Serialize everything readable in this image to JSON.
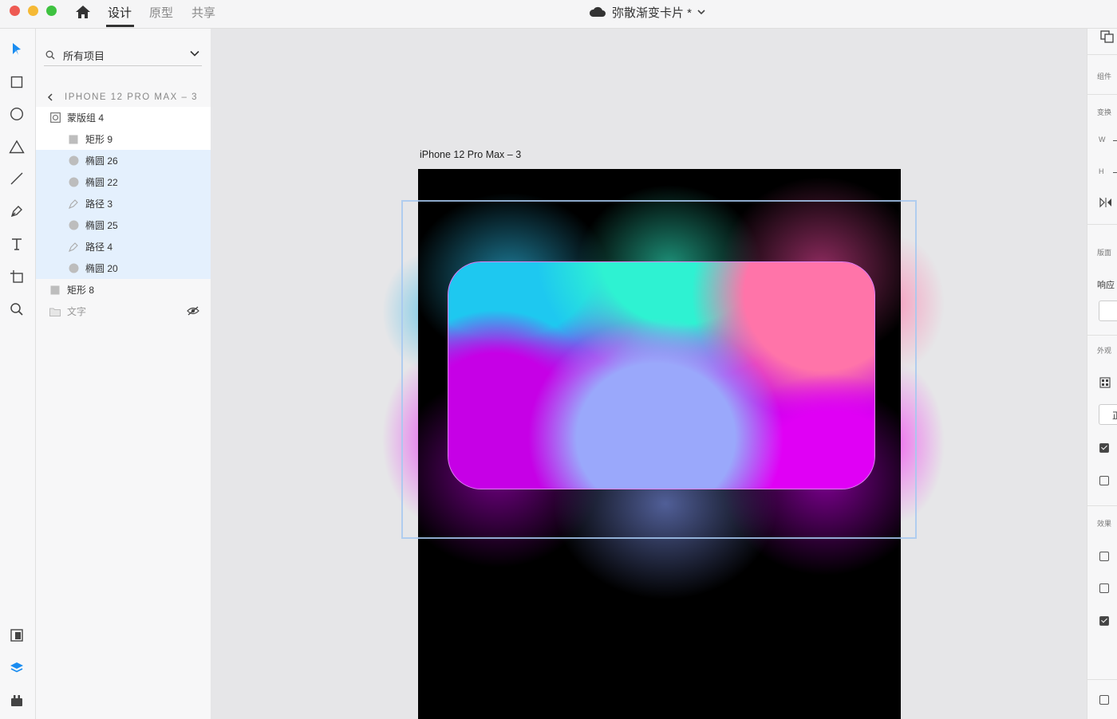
{
  "window": {
    "tabs": [
      {
        "label": "设计",
        "active": true
      },
      {
        "label": "原型",
        "active": false
      },
      {
        "label": "共享",
        "active": false
      }
    ],
    "doc_title": "弥散渐变卡片 *",
    "icons": [
      "home-icon",
      "cloud-icon",
      "chevron-down-icon"
    ]
  },
  "toolbar": {
    "tools": [
      "select-icon",
      "rectangle-icon",
      "ellipse-icon",
      "polygon-icon",
      "line-icon",
      "pen-icon",
      "text-icon",
      "artboard-icon",
      "zoom-icon"
    ],
    "bottom_tools": [
      "assets-icon",
      "layers-icon",
      "plugins-icon"
    ]
  },
  "layers": {
    "search_placeholder": "所有项目",
    "breadcrumb": "IPHONE 12 PRO MAX – 3",
    "items": [
      {
        "label": "蒙版组 4",
        "icon": "mask-group-icon",
        "state": "white"
      },
      {
        "label": "矩形 9",
        "icon": "rectangle-layer-icon",
        "state": "white"
      },
      {
        "label": "椭圆 26",
        "icon": "ellipse-layer-icon",
        "state": "selected"
      },
      {
        "label": "椭圆 22",
        "icon": "ellipse-layer-icon",
        "state": "selected"
      },
      {
        "label": "路径 3",
        "icon": "path-layer-icon",
        "state": "selected"
      },
      {
        "label": "椭圆 25",
        "icon": "ellipse-layer-icon",
        "state": "selected"
      },
      {
        "label": "路径 4",
        "icon": "path-layer-icon",
        "state": "selected"
      },
      {
        "label": "椭圆 20",
        "icon": "ellipse-layer-icon",
        "state": "selected"
      },
      {
        "label": "矩形 8",
        "icon": "rectangle-layer-icon",
        "state": "none"
      },
      {
        "label": "文字",
        "icon": "folder-icon",
        "state": "hidden"
      }
    ]
  },
  "canvas": {
    "artboard_label": "iPhone 12 Pro Max – 3",
    "colors": {
      "artboard": "#000000",
      "cyan": "#1ec8f0",
      "mint": "#2ef2d2",
      "pink": "#ff74a9",
      "magenta": "#c600e6",
      "periwinkle": "#9aa8fb",
      "violet": "#e000f5",
      "selection": "#a6c8f0"
    }
  },
  "right_panel": {
    "labels": {
      "components": "组件",
      "transform": "变换",
      "w": "W",
      "h": "H",
      "layout": "版面",
      "responsive": "响应",
      "appearance": "外观",
      "normal": "正",
      "effects": "效果"
    },
    "checkboxes": [
      true,
      false,
      false,
      false,
      true,
      false
    ]
  }
}
